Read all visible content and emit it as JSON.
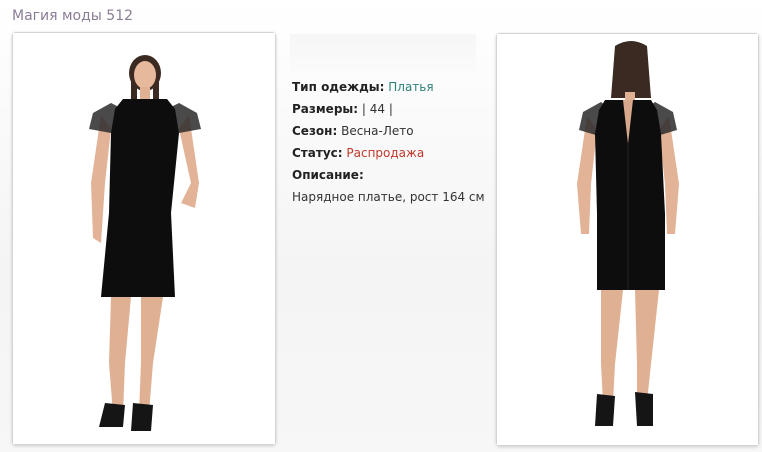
{
  "page": {
    "title": "Магия моды 512"
  },
  "product": {
    "type_label": "Тип одежды:",
    "type_value": "Платья",
    "sizes_label": "Размеры:",
    "sizes_value": "| 44 |",
    "season_label": "Сезон:",
    "season_value": "Весна-Лето",
    "status_label": "Статус:",
    "status_value": "Распродажа",
    "description_label": "Описание:",
    "description_value": "Нарядное платье,  рост 164 см"
  },
  "colors": {
    "title": "#8a7e96",
    "link": "#2f7f7a",
    "status": "#c0392b"
  },
  "images": {
    "front": "model-front-view-image",
    "back": "model-back-view-image"
  }
}
